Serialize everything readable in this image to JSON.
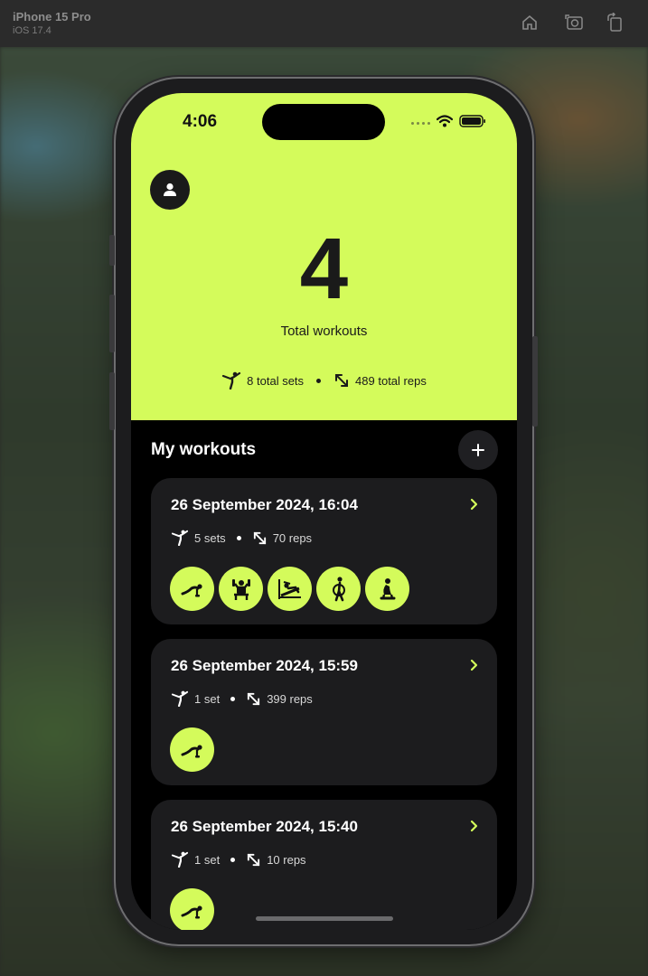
{
  "simulator": {
    "device": "iPhone 15 Pro",
    "os": "iOS 17.4",
    "buttons": [
      "home-icon",
      "screenshot-icon",
      "rotate-icon"
    ]
  },
  "status_bar": {
    "time": "4:06"
  },
  "colors": {
    "accent": "#d4fb5b",
    "card": "#1c1c1e",
    "background": "#000000"
  },
  "summary": {
    "total_workouts": "4",
    "total_workouts_label": "Total workouts",
    "total_sets": "8 total sets",
    "total_reps": "489 total reps"
  },
  "workouts_section": {
    "title": "My workouts"
  },
  "workouts": [
    {
      "date": "26 September 2024, 16:04",
      "sets": "5 sets",
      "reps": "70 reps",
      "exercises": [
        "pushup-icon",
        "dumbbell-press-icon",
        "incline-bench-icon",
        "barbell-curl-icon",
        "squat-icon"
      ]
    },
    {
      "date": "26 September 2024, 15:59",
      "sets": "1 set",
      "reps": "399 reps",
      "exercises": [
        "pushup-icon"
      ]
    },
    {
      "date": "26 September 2024, 15:40",
      "sets": "1 set",
      "reps": "10 reps",
      "exercises": [
        "pushup-icon"
      ]
    }
  ]
}
